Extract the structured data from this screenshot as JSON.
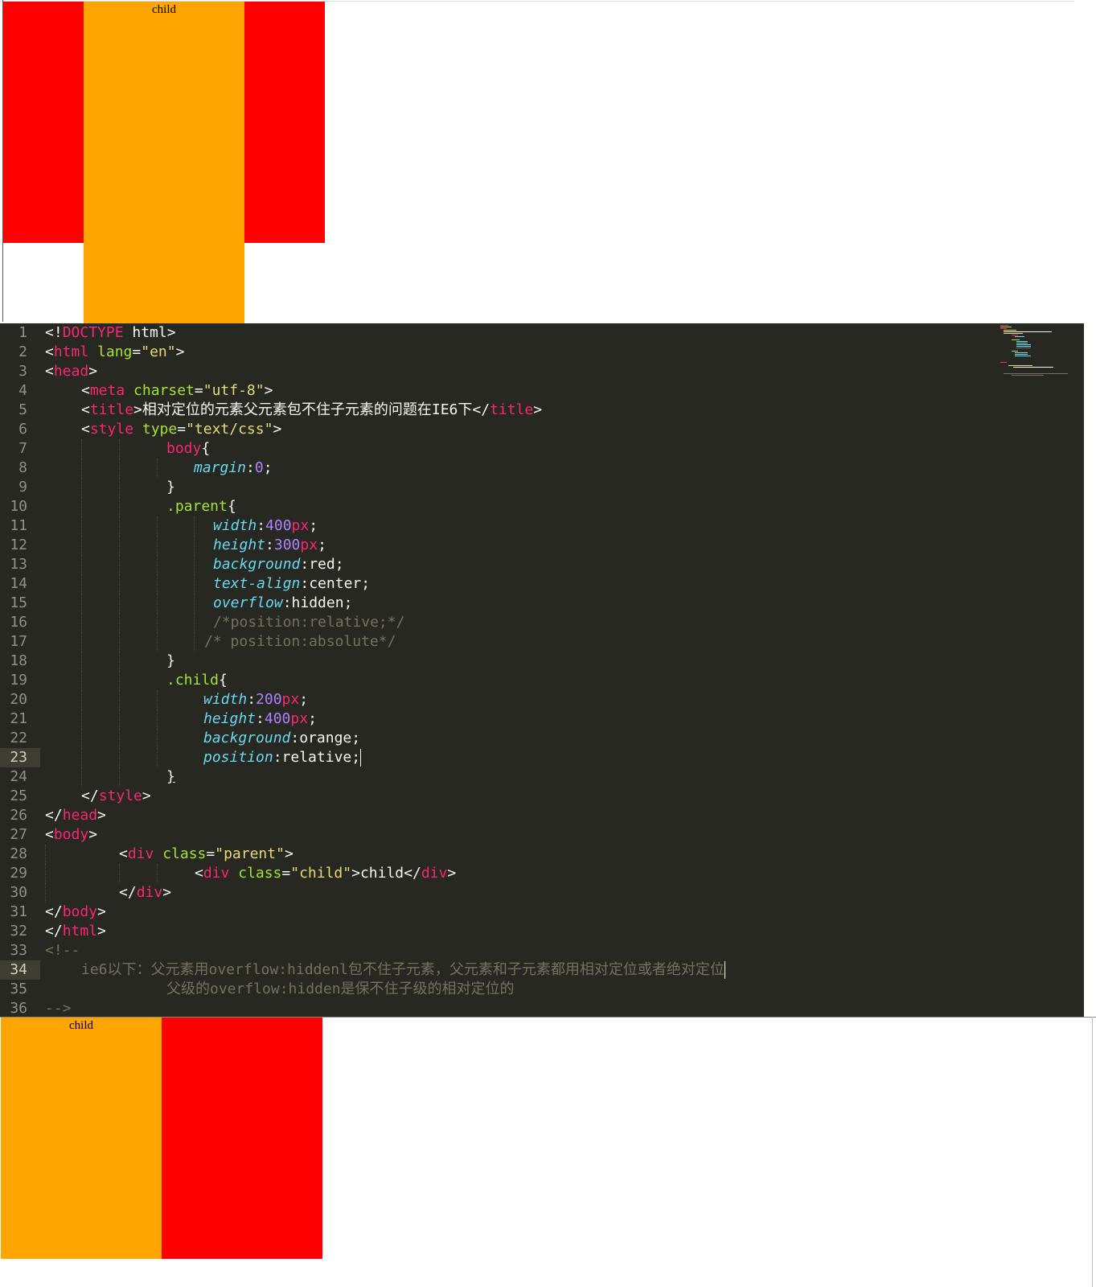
{
  "preview_top": {
    "child_text": "child",
    "parent_color": "#ff0000",
    "child_color": "#ffa500"
  },
  "editor": {
    "background": "#272822",
    "lines": [
      {
        "n": "1"
      },
      {
        "n": "2"
      },
      {
        "n": "3"
      },
      {
        "n": "4"
      },
      {
        "n": "5"
      },
      {
        "n": "6"
      },
      {
        "n": "7"
      },
      {
        "n": "8"
      },
      {
        "n": "9"
      },
      {
        "n": "10"
      },
      {
        "n": "11"
      },
      {
        "n": "12"
      },
      {
        "n": "13"
      },
      {
        "n": "14"
      },
      {
        "n": "15"
      },
      {
        "n": "16"
      },
      {
        "n": "17"
      },
      {
        "n": "18"
      },
      {
        "n": "19"
      },
      {
        "n": "20"
      },
      {
        "n": "21"
      },
      {
        "n": "22"
      },
      {
        "n": "23"
      },
      {
        "n": "24"
      },
      {
        "n": "25"
      },
      {
        "n": "26"
      },
      {
        "n": "27"
      },
      {
        "n": "28"
      },
      {
        "n": "29"
      },
      {
        "n": "30"
      },
      {
        "n": "31"
      },
      {
        "n": "32"
      },
      {
        "n": "33"
      },
      {
        "n": "34"
      },
      {
        "n": "35"
      },
      {
        "n": "36"
      }
    ],
    "active_line": "23",
    "tok": {
      "lt": "<",
      "gt": ">",
      "lt_slash": "</",
      "bang": "<!",
      "eq": "=",
      "doctype": "DOCTYPE",
      "html_word": " html",
      "html": "html",
      "lang": " lang",
      "en": "\"en\"",
      "head": "head",
      "meta": "meta",
      "charset": " charset",
      "utf8": "\"utf-8\"",
      "title": "title",
      "title_text": "相对定位的元素父元素包不住子元素的问题在IE6下",
      "style": "style",
      "type": " type",
      "textcss": "\"text/css\"",
      "body_sel": "body",
      "lbrace": "{",
      "rbrace": "}",
      "margin": "margin",
      "colon": ":",
      "zero": "0",
      "semi": ";",
      "parent_sel": ".parent",
      "width": "width",
      "height": "height",
      "background": "background",
      "text_align": "text-align",
      "overflow": "overflow",
      "n400": "400",
      "n300": "300",
      "n200": "200",
      "px": "px",
      "red": "red",
      "center": "center",
      "hidden": "hidden",
      "cmt16": "/*position:relative;*/",
      "cmt17": "/* position:absolute*/",
      "child_sel": ".child",
      "orange": "orange",
      "position": "position",
      "relative": "relative",
      "body": "body",
      "div": "div",
      "class": " class",
      "parent_str": "\"parent\"",
      "child_str": "\"child\"",
      "child_txt": "child",
      "cmt_open": "<!--",
      "cmt34": "ie6以下：父元素用overflow:hiddenl包不住子元素，父元素和子元素都用相对定位或者绝对定位",
      "cmt35": "父级的overflow:hidden是保不住子级的相对定位的",
      "cmt_close": "-->"
    }
  },
  "preview_bottom": {
    "child_text": "child",
    "parent_color": "#ff0000",
    "child_color": "#ffa500"
  }
}
